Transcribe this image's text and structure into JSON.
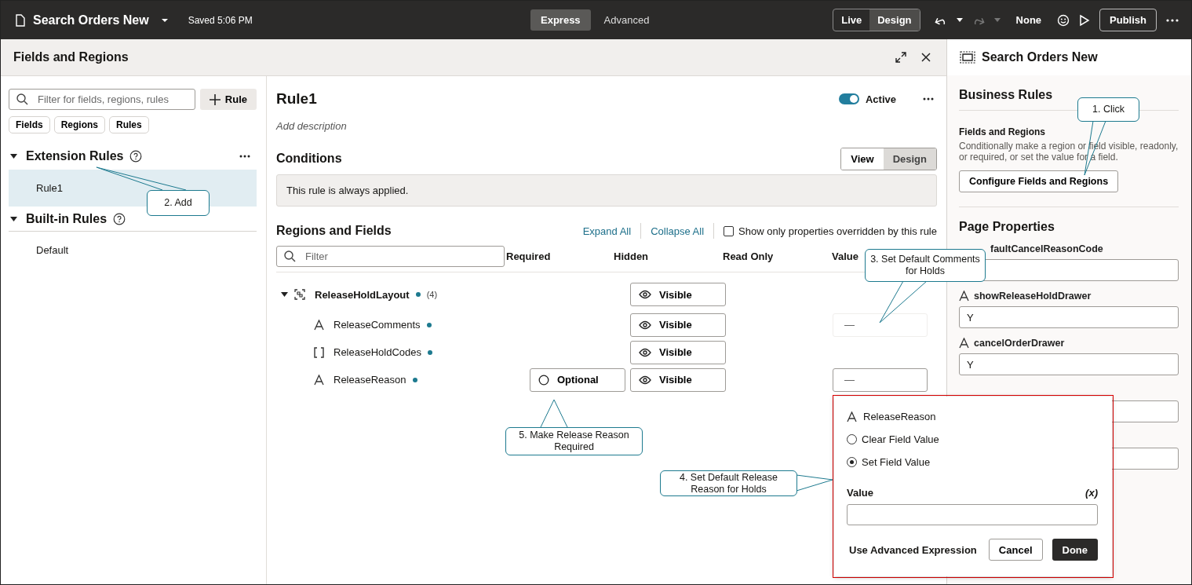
{
  "top_bar": {
    "title": "Search Orders New",
    "saved": "Saved 5:06 PM",
    "modes": [
      {
        "label": "Express",
        "selected": true
      },
      {
        "label": "Advanced",
        "selected": false
      }
    ],
    "view_modes": [
      {
        "label": "Live",
        "selected": false
      },
      {
        "label": "Design",
        "selected": true
      }
    ],
    "redo_disabled": true,
    "preview_label": "None",
    "publish": "Publish"
  },
  "panel": {
    "title": "Fields and Regions"
  },
  "sidebar": {
    "filter_placeholder": "Filter for fields, regions, rules",
    "add_rule": "Rule",
    "chips": [
      "Fields",
      "Regions",
      "Rules"
    ],
    "groups": [
      {
        "title": "Extension Rules",
        "expanded": true,
        "has_menu": true,
        "items": [
          {
            "label": "Rule1",
            "selected": true
          }
        ]
      },
      {
        "title": "Built-in Rules",
        "expanded": true,
        "has_menu": false,
        "items": [
          {
            "label": "Default",
            "selected": false
          }
        ]
      }
    ]
  },
  "rule": {
    "title": "Rule1",
    "active": true,
    "active_label": "Active",
    "description_placeholder": "Add description",
    "conditions_title": "Conditions",
    "condition_modes": [
      {
        "label": "View",
        "selected": false
      },
      {
        "label": "Design",
        "selected": true
      }
    ],
    "condition_text": "This rule is always applied.",
    "regions_title": "Regions and Fields",
    "expand_all": "Expand All",
    "collapse_all": "Collapse All",
    "override_filter": {
      "label": "Show only properties overridden by this rule",
      "checked": false
    },
    "filter_placeholder": "Filter",
    "columns": [
      "Required",
      "Hidden",
      "Read Only",
      "Value"
    ],
    "rows": [
      {
        "kind": "region",
        "name": "ReleaseHoldLayout",
        "count": "(4)",
        "expanded": true,
        "hidden": "Visible"
      },
      {
        "kind": "text",
        "name": "ReleaseComments",
        "hidden": "Visible",
        "value": "—",
        "value_active": false
      },
      {
        "kind": "list",
        "name": "ReleaseHoldCodes",
        "hidden": "Visible"
      },
      {
        "kind": "text",
        "name": "ReleaseReason",
        "required": "Optional",
        "hidden": "Visible",
        "value": "—",
        "value_active": true
      }
    ]
  },
  "inspector": {
    "title": "Search Orders New",
    "section": "Business Rules",
    "subsection": "Fields and Regions",
    "description": "Conditionally make a region or field visible, readonly, or required, or set the value for a field.",
    "button": "Configure Fields and Regions",
    "properties_title": "Page Properties",
    "properties": [
      {
        "kind": "cut",
        "label": "faultCancelReasonCode"
      },
      {
        "kind": "text",
        "label": "showReleaseHoldDrawer",
        "value": "Y"
      },
      {
        "kind": "text",
        "label": "cancelOrderDrawer",
        "value": "Y"
      },
      {
        "kind": "covered"
      },
      {
        "kind": "covered"
      }
    ]
  },
  "popup": {
    "field": "ReleaseReason",
    "options": [
      {
        "label": "Clear Field Value",
        "selected": false
      },
      {
        "label": "Set Field Value",
        "selected": true
      }
    ],
    "value_label": "Value",
    "expression_hint": "(x)",
    "advanced": "Use Advanced Expression",
    "cancel": "Cancel",
    "done": "Done"
  },
  "callouts": [
    {
      "text": "1. Click"
    },
    {
      "text": "2. Add"
    },
    {
      "text": "3. Set Default Comments for Holds"
    },
    {
      "text": "4. Set Default Release Reason for Holds"
    },
    {
      "text": "5. Make Release Reason Required"
    }
  ]
}
